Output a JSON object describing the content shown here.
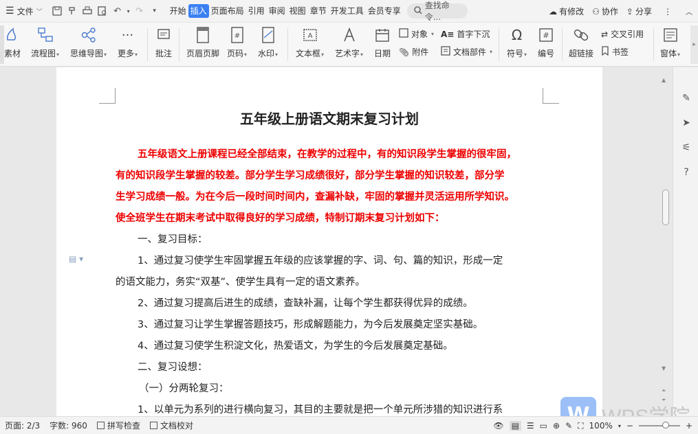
{
  "menubar": {
    "file_label": "文件",
    "tabs": [
      "开始",
      "插入",
      "页面布局",
      "引用",
      "审阅",
      "视图",
      "章节",
      "开发工具",
      "会员专享"
    ],
    "active_tab": "插入",
    "search_placeholder": "查找命令...",
    "right": {
      "modified": "有修改",
      "collab": "协作",
      "share": "分享"
    }
  },
  "ribbon": {
    "material": "素材",
    "flowchart": "流程图",
    "mindmap": "思维导图",
    "more": "更多",
    "comment": "批注",
    "header_footer": "页眉页脚",
    "page_number": "页码",
    "watermark": "水印",
    "textbox": "文本框",
    "wordart": "艺术字",
    "date": "日期",
    "object": "对象",
    "attachment": "附件",
    "dropcap": "首字下沉",
    "doc_parts": "文档部件",
    "symbol": "符号",
    "numbering": "编号",
    "hyperlink": "超链接",
    "crossref": "交叉引用",
    "bookmark": "书签",
    "window": "窗体"
  },
  "document": {
    "title": "五年级上册语文期末复习计划",
    "intro_lines": [
      "五年级语文上册课程已经全部结束，在教学的过程中，有的知识段学生掌握的很牢固，",
      "有的知识段学生掌握的较差。部分学生学习成绩很好，部分学生掌握的知识较差，部分学",
      "生学习成绩一般。为在今后一段时间时间内，查漏补缺，牢固的掌握并灵活运用所学知识。",
      "使全班学生在期末考试中取得良好的学习成绩，特制订期末复习计划如下："
    ],
    "section1": "一、复习目标：",
    "goal1_a": "1、通过复习使学生牢固掌握五年级的应该掌握的字、词、句、篇的知识，形成一定",
    "goal1_b": "的语文能力，务实“双基”、使学生具有一定的语文素养。",
    "goal2": "2、通过复习提高后进生的成绩，查缺补漏，让每个学生都获得优异的成绩。",
    "goal3": "3、通过复习让学生掌握答题技巧，形成解题能力，为今后发展奠定坚实基础。",
    "goal4": "4、通过复习使学生积淀文化，热爱语文，为学生的今后发展奠定基础。",
    "section2": "二、复习设想：",
    "sub1": "（一）分两轮复习：",
    "cut_line": "1、以单元为系列的进行横向复习，其目的主要就是把一个单元所涉猎的知识进行系"
  },
  "statusbar": {
    "page": "页面: 2/3",
    "words": "字数: 960",
    "spellcheck": "拼写检查",
    "proofread": "文档校对",
    "zoom": "100%"
  },
  "watermark_logo": {
    "mark": "W",
    "text": "WPS学院"
  }
}
